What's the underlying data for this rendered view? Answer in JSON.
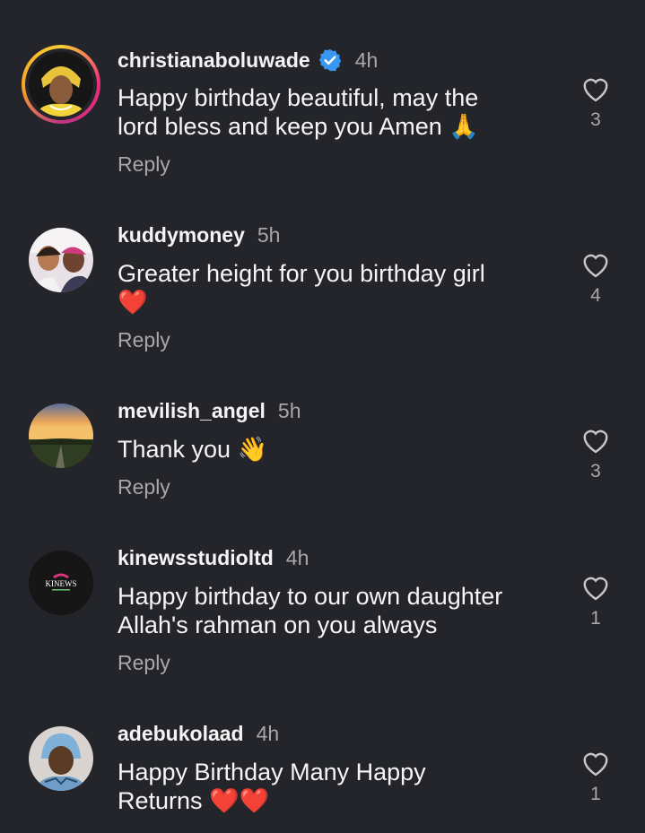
{
  "comments": [
    {
      "username": "christianaboluwade",
      "verified": true,
      "time": "4h",
      "text": "Happy birthday beautiful, may the\nlord bless and keep you Amen 🙏",
      "reply_label": "Reply",
      "likes": "3",
      "avatar_icon": "profile-photo-woman-yellow-headwrap",
      "has_story": true
    },
    {
      "username": "kuddymoney",
      "verified": false,
      "time": "5h",
      "text": "Greater height for you birthday girl\n❤️",
      "reply_label": "Reply",
      "likes": "4",
      "avatar_icon": "profile-photo-two-women",
      "has_story": false
    },
    {
      "username": "mevilish_angel",
      "verified": false,
      "time": "5h",
      "text": "Thank you 👋",
      "reply_label": "Reply",
      "likes": "3",
      "avatar_icon": "profile-photo-sunset-field",
      "has_story": false
    },
    {
      "username": "kinewsstudioltd",
      "verified": false,
      "time": "4h",
      "text": "Happy birthday to our own daughter\nAllah's rahman on you always",
      "reply_label": "Reply",
      "likes": "1",
      "avatar_icon": "kinews-logo",
      "logo_text": "KINEWS",
      "has_story": false
    },
    {
      "username": "adebukolaad",
      "verified": false,
      "time": "4h",
      "text": "Happy Birthday Many Happy\nReturns ❤️❤️",
      "reply_label": "",
      "likes": "1",
      "avatar_icon": "profile-photo-woman-headscarf",
      "has_story": false
    }
  ],
  "colors": {
    "background": "#24252a",
    "text": "#f6f6f6",
    "muted": "#a8a8a8",
    "verified": "#3897f0"
  }
}
